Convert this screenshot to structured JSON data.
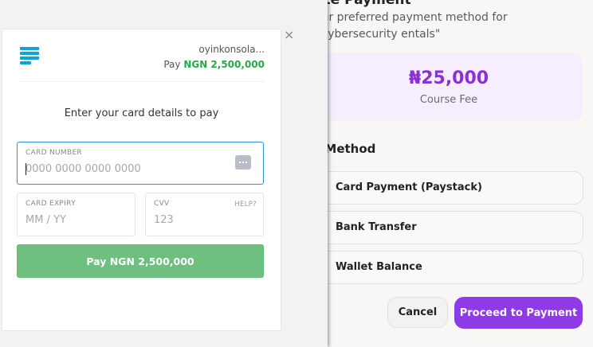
{
  "course_modal": {
    "title": "ete Payment",
    "description": "our preferred payment method for \"Cybersecurity entals\"",
    "fee_amount": "₦25,000",
    "fee_label": "Course Fee",
    "method_heading": "t Method",
    "options": [
      {
        "label": "Card Payment (Paystack)"
      },
      {
        "label": "Bank Transfer"
      },
      {
        "label": "Wallet Balance"
      }
    ],
    "cancel_label": "Cancel",
    "proceed_label": "Proceed to Payment",
    "accent_color": "#8e3ae6"
  },
  "paystack": {
    "merchant": "oyinkonsola...",
    "pay_prefix": "Pay",
    "pay_amount": "NGN 2,500,000",
    "instruction": "Enter your card details to pay",
    "card_number_label": "CARD NUMBER",
    "card_number_placeholder": "0000 0000 0000 0000",
    "expiry_label": "CARD EXPIRY",
    "expiry_placeholder": "MM / YY",
    "cvv_label": "CVV",
    "cvv_help": "HELP?",
    "cvv_placeholder": "123",
    "pay_button_label": "Pay NGN 2,500,000",
    "close_icon": "×",
    "pay_button_color": "#6fc07f",
    "amount_color": "#29a847"
  }
}
